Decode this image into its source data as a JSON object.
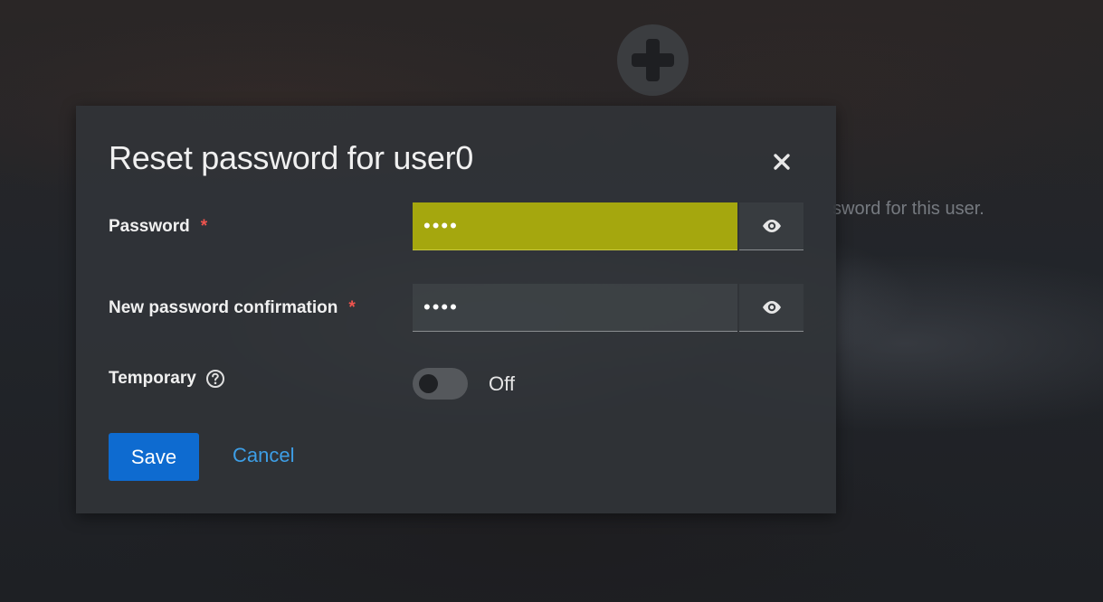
{
  "background": {
    "hint_text": "sword for this user."
  },
  "modal": {
    "title": "Reset password for user0",
    "fields": {
      "password": {
        "label": "Password",
        "required_mark": "*",
        "value": "••••"
      },
      "confirmation": {
        "label": "New password confirmation",
        "required_mark": "*",
        "value": "••••"
      },
      "temporary": {
        "label": "Temporary",
        "state_text": "Off",
        "on": false
      }
    },
    "actions": {
      "save_label": "Save",
      "cancel_label": "Cancel"
    }
  },
  "icons": {
    "close": "close-icon",
    "show_password": "eye-icon",
    "help": "help-icon",
    "add": "plus-icon"
  },
  "colors": {
    "primary": "#0e6bd0",
    "link": "#3d9ee6",
    "required": "#f0544e",
    "focused_field": "#a5a70e"
  }
}
